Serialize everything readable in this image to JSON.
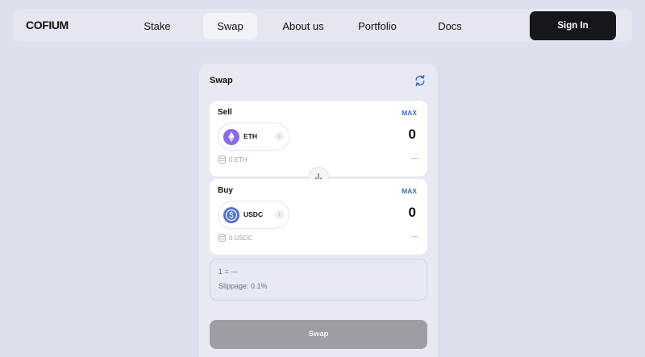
{
  "nav": {
    "logo": "COFIUM",
    "items": [
      {
        "label": "Stake"
      },
      {
        "label": "Swap",
        "active": true
      },
      {
        "label": "About us"
      },
      {
        "label": "Portfolio"
      },
      {
        "label": "Docs"
      }
    ],
    "signin_label": "Sign In"
  },
  "swap_card": {
    "title": "Swap",
    "refresh_icon": "refresh-icon",
    "sell": {
      "label": "Sell",
      "max_label": "MAX",
      "token": "ETH",
      "amount": "0",
      "balance": "0 ETH",
      "usd_value": "—"
    },
    "buy": {
      "label": "Buy",
      "max_label": "MAX",
      "token": "USDC",
      "amount": "0",
      "balance": "0 USDC",
      "usd_value": "—"
    },
    "rate": "1 = —",
    "slippage": "Slippage: 0.1%",
    "swap_button": "Swap"
  },
  "colors": {
    "background": "#dde1ed",
    "accent_blue": "#3f6bc4",
    "eth_purple": "#8a6ae6",
    "usdc_blue": "#4d74c8",
    "disabled_button": "#9c9ea4",
    "signin_bg": "#15171c"
  }
}
